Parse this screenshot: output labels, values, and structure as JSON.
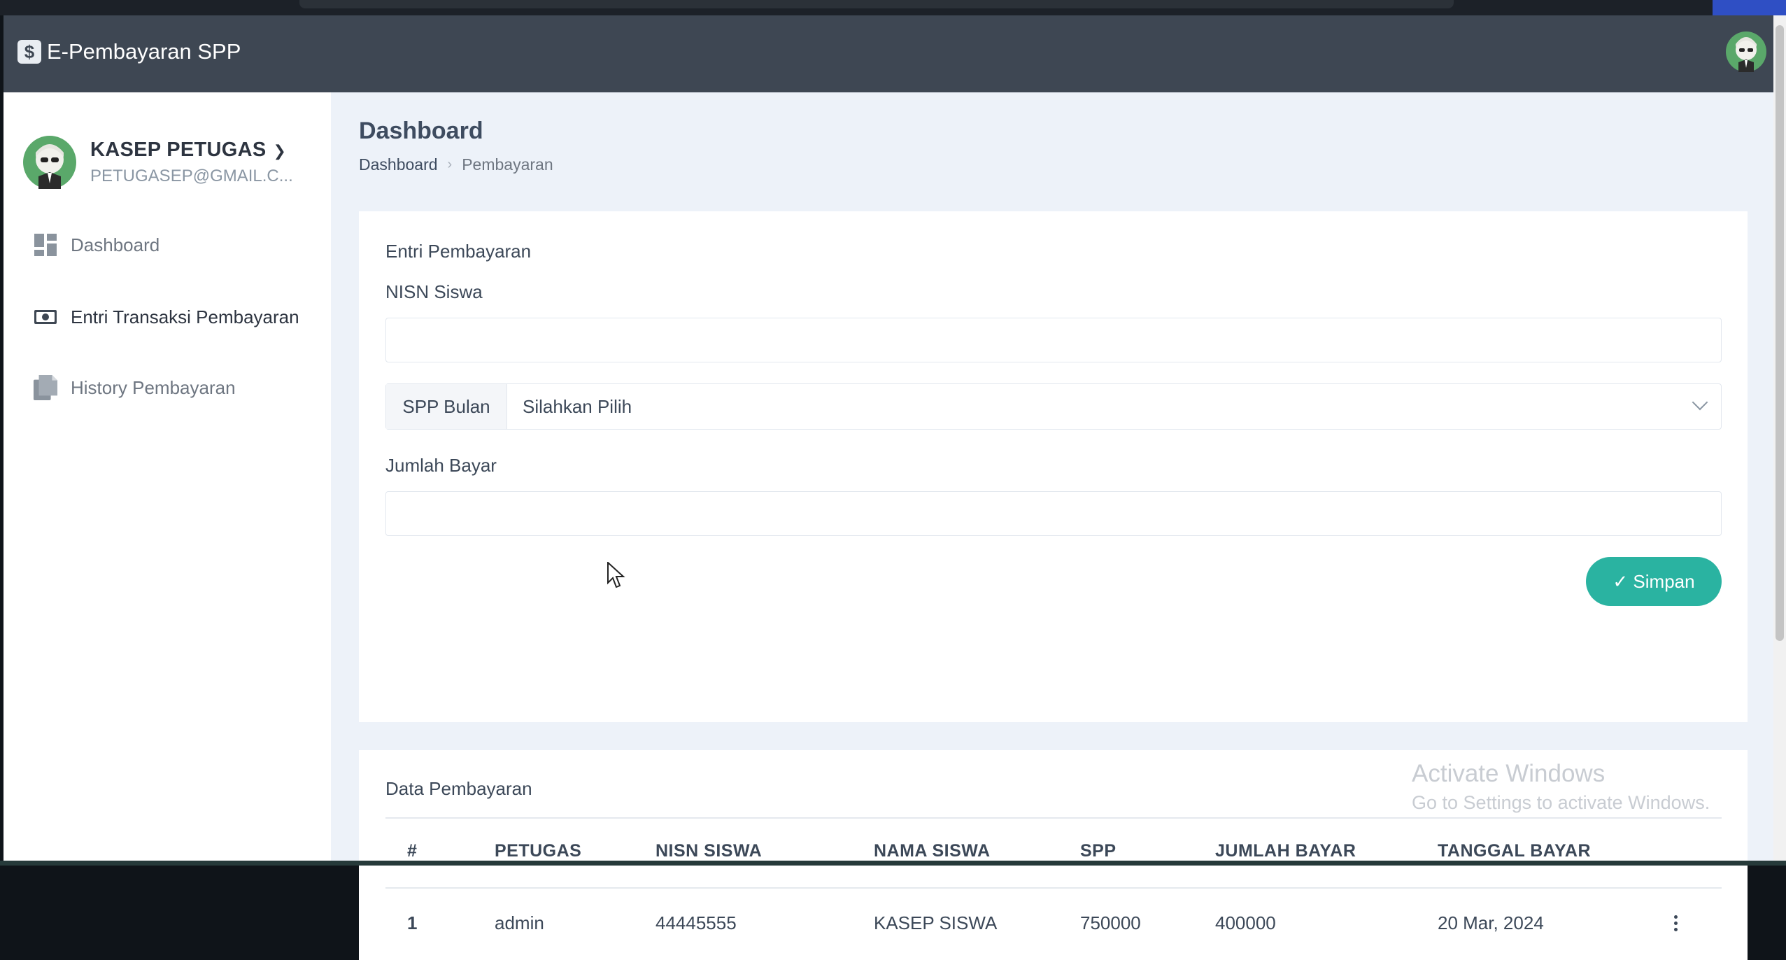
{
  "app": {
    "brand_icon": "dollar-icon",
    "brand_title": "E-Pembayaran SPP"
  },
  "user": {
    "name": "KASEP PETUGAS",
    "email": "PETUGASEP@GMAIL.C..."
  },
  "sidebar": {
    "items": [
      {
        "label": "Dashboard",
        "icon": "dashboard-grid-icon"
      },
      {
        "label": "Entri Transaksi Pembayaran",
        "icon": "money-bill-icon"
      },
      {
        "label": "History Pembayaran",
        "icon": "document-copy-icon"
      }
    ]
  },
  "page": {
    "title": "Dashboard",
    "breadcrumb": [
      "Dashboard",
      "Pembayaran"
    ]
  },
  "form": {
    "title": "Entri Pembayaran",
    "nisn_label": "NISN Siswa",
    "nisn_value": "",
    "spp_addon": "SPP Bulan",
    "spp_selected": "Silahkan Pilih",
    "jumlah_label": "Jumlah Bayar",
    "jumlah_value": "",
    "submit_label": "✓ Simpan"
  },
  "table": {
    "title": "Data Pembayaran",
    "headers": [
      "#",
      "PETUGAS",
      "NISN SISWA",
      "NAMA SISWA",
      "SPP",
      "JUMLAH BAYAR",
      "TANGGAL BAYAR"
    ],
    "rows": [
      [
        "1",
        "admin",
        "44445555",
        "KASEP SISWA",
        "750000",
        "400000",
        "20 Mar, 2024"
      ]
    ]
  },
  "watermark": {
    "line1": "Activate Windows",
    "line2": "Go to Settings to activate Windows."
  },
  "colors": {
    "navbar": "#3e4753",
    "accent": "#2ab3a1",
    "content_bg": "#edf2f9"
  }
}
